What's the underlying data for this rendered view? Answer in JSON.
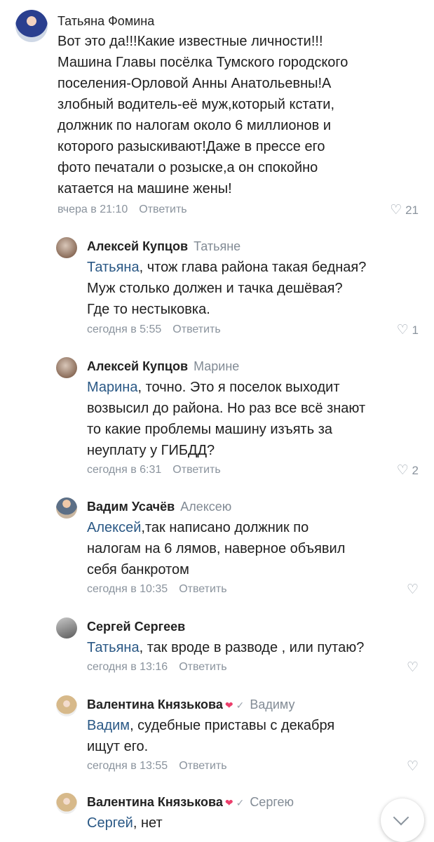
{
  "icons": {
    "avatar": "user-photo",
    "like": "heart-icon",
    "scroll": "chevron-down-icon",
    "badge": "heart-badge",
    "verified": "check-icon"
  },
  "comments": [
    {
      "author": "Татьяна Фомина",
      "text": "Вот это да!!!Какие известные личности!!!\nМашина Главы посёлка Тумского городского\nпоселения-Орловой Анны Анатольевны!А\nзлобный водитель-её муж,который кстати,\nдолжник по налогам около 6 миллионов и\nкоторого разыскивают!Даже в прессе его\nфото печатали о розыске,а он спокойно\nкатается на машине жены!",
      "time": "вчера в 21:10",
      "reply_label": "Ответить",
      "likes": "21"
    },
    {
      "author": "Алексей Купцов",
      "reply_to": "Татьяне",
      "mention": "Татьяна",
      "text": ", чтож глава района такая бедная?\nМуж столько должен и тачка дешёвая?\nГде то нестыковка.",
      "time": "сегодня в 5:55",
      "reply_label": "Ответить",
      "likes": "1"
    },
    {
      "author": "Алексей Купцов",
      "reply_to": "Марине",
      "mention": "Марина",
      "text": ", точно. Это я поселок выходит\nвозвысил до района. Но раз все всё знают\nто какие проблемы машину изъять за\nнеуплату у ГИБДД?",
      "time": "сегодня в 6:31",
      "reply_label": "Ответить",
      "likes": "2"
    },
    {
      "author": "Вадим Усачёв",
      "reply_to": "Алексею",
      "mention": "Алексей",
      "text": ",так написано должник по\nналогам на 6 лямов, наверное объявил\nсебя банкротом",
      "time": "сегодня в 10:35",
      "reply_label": "Ответить",
      "likes": ""
    },
    {
      "author": "Сергей Сергеев",
      "reply_to": "",
      "mention": "Татьяна",
      "text": ", так вроде в разводе , или путаю?",
      "time": "сегодня в 13:16",
      "reply_label": "Ответить",
      "likes": ""
    },
    {
      "author": "Валентина Князькова",
      "reply_to": "Вадиму",
      "mention": "Вадим",
      "text": ", судебные приставы с декабря\nищут его.",
      "time": "сегодня в 13:55",
      "reply_label": "Ответить",
      "likes": ""
    },
    {
      "author": "Валентина Князькова",
      "reply_to": "Сергею",
      "mention": "Сергей",
      "text": ", нет",
      "time": "",
      "reply_label": "",
      "likes": ""
    }
  ]
}
